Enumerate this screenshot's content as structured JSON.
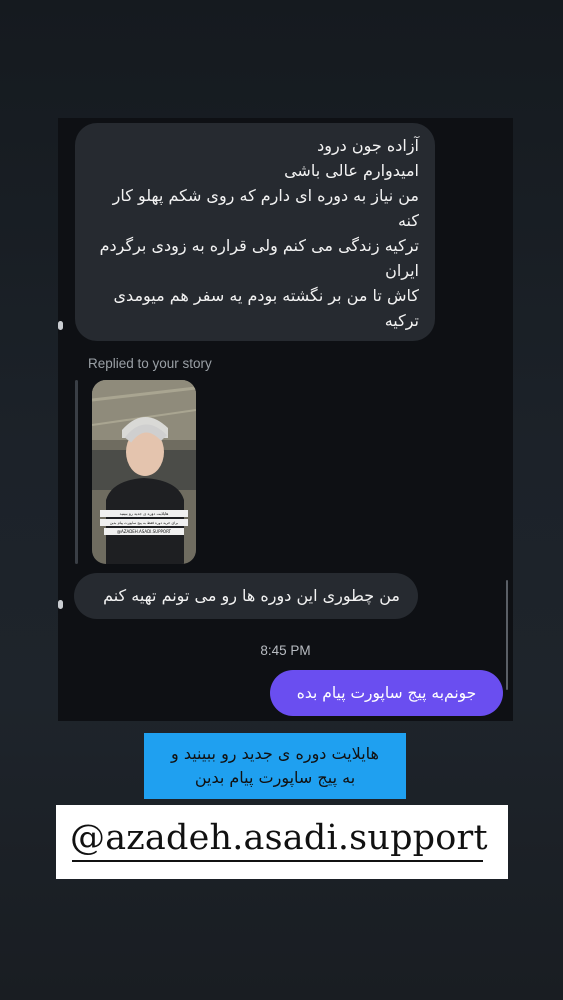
{
  "chat": {
    "incoming_message_1": [
      "آزاده جون درود",
      "امیدوارم عالی باشی",
      "من نیاز به دوره ای دارم که روی شکم پهلو کار کنه",
      "ترکیه زندگی می کنم ولی قراره به زودی برگردم ایران",
      "کاش تا من بر نگشته بودم یه سفر هم میومدی ترکیه"
    ],
    "reply_label": "Replied to your story",
    "story_thumbnail": {
      "caption_lines": [
        "هایلایت دوره ی جدید رو ببینید",
        "برای خرید دوره فقط به پیج ساپورت پیام بدین",
        "@AZADEH.ASADI.SUPPORT"
      ]
    },
    "incoming_message_2": "من چطوری این دوره ها رو می تونم تهیه کنم",
    "timestamp": "8:45 PM",
    "outgoing_message": "جونم‌به پیج ساپورت پیام بده"
  },
  "overlay": {
    "caption_line1": "هایلایت دوره ی جدید رو ببینید و",
    "caption_line2": "به پیج ساپورت پیام بدین",
    "handle": "@azadeh.asadi.support"
  },
  "colors": {
    "outgoing_bubble": "#6a4ef0",
    "incoming_bubble": "#262a30",
    "caption_background": "#1fa0f0"
  }
}
